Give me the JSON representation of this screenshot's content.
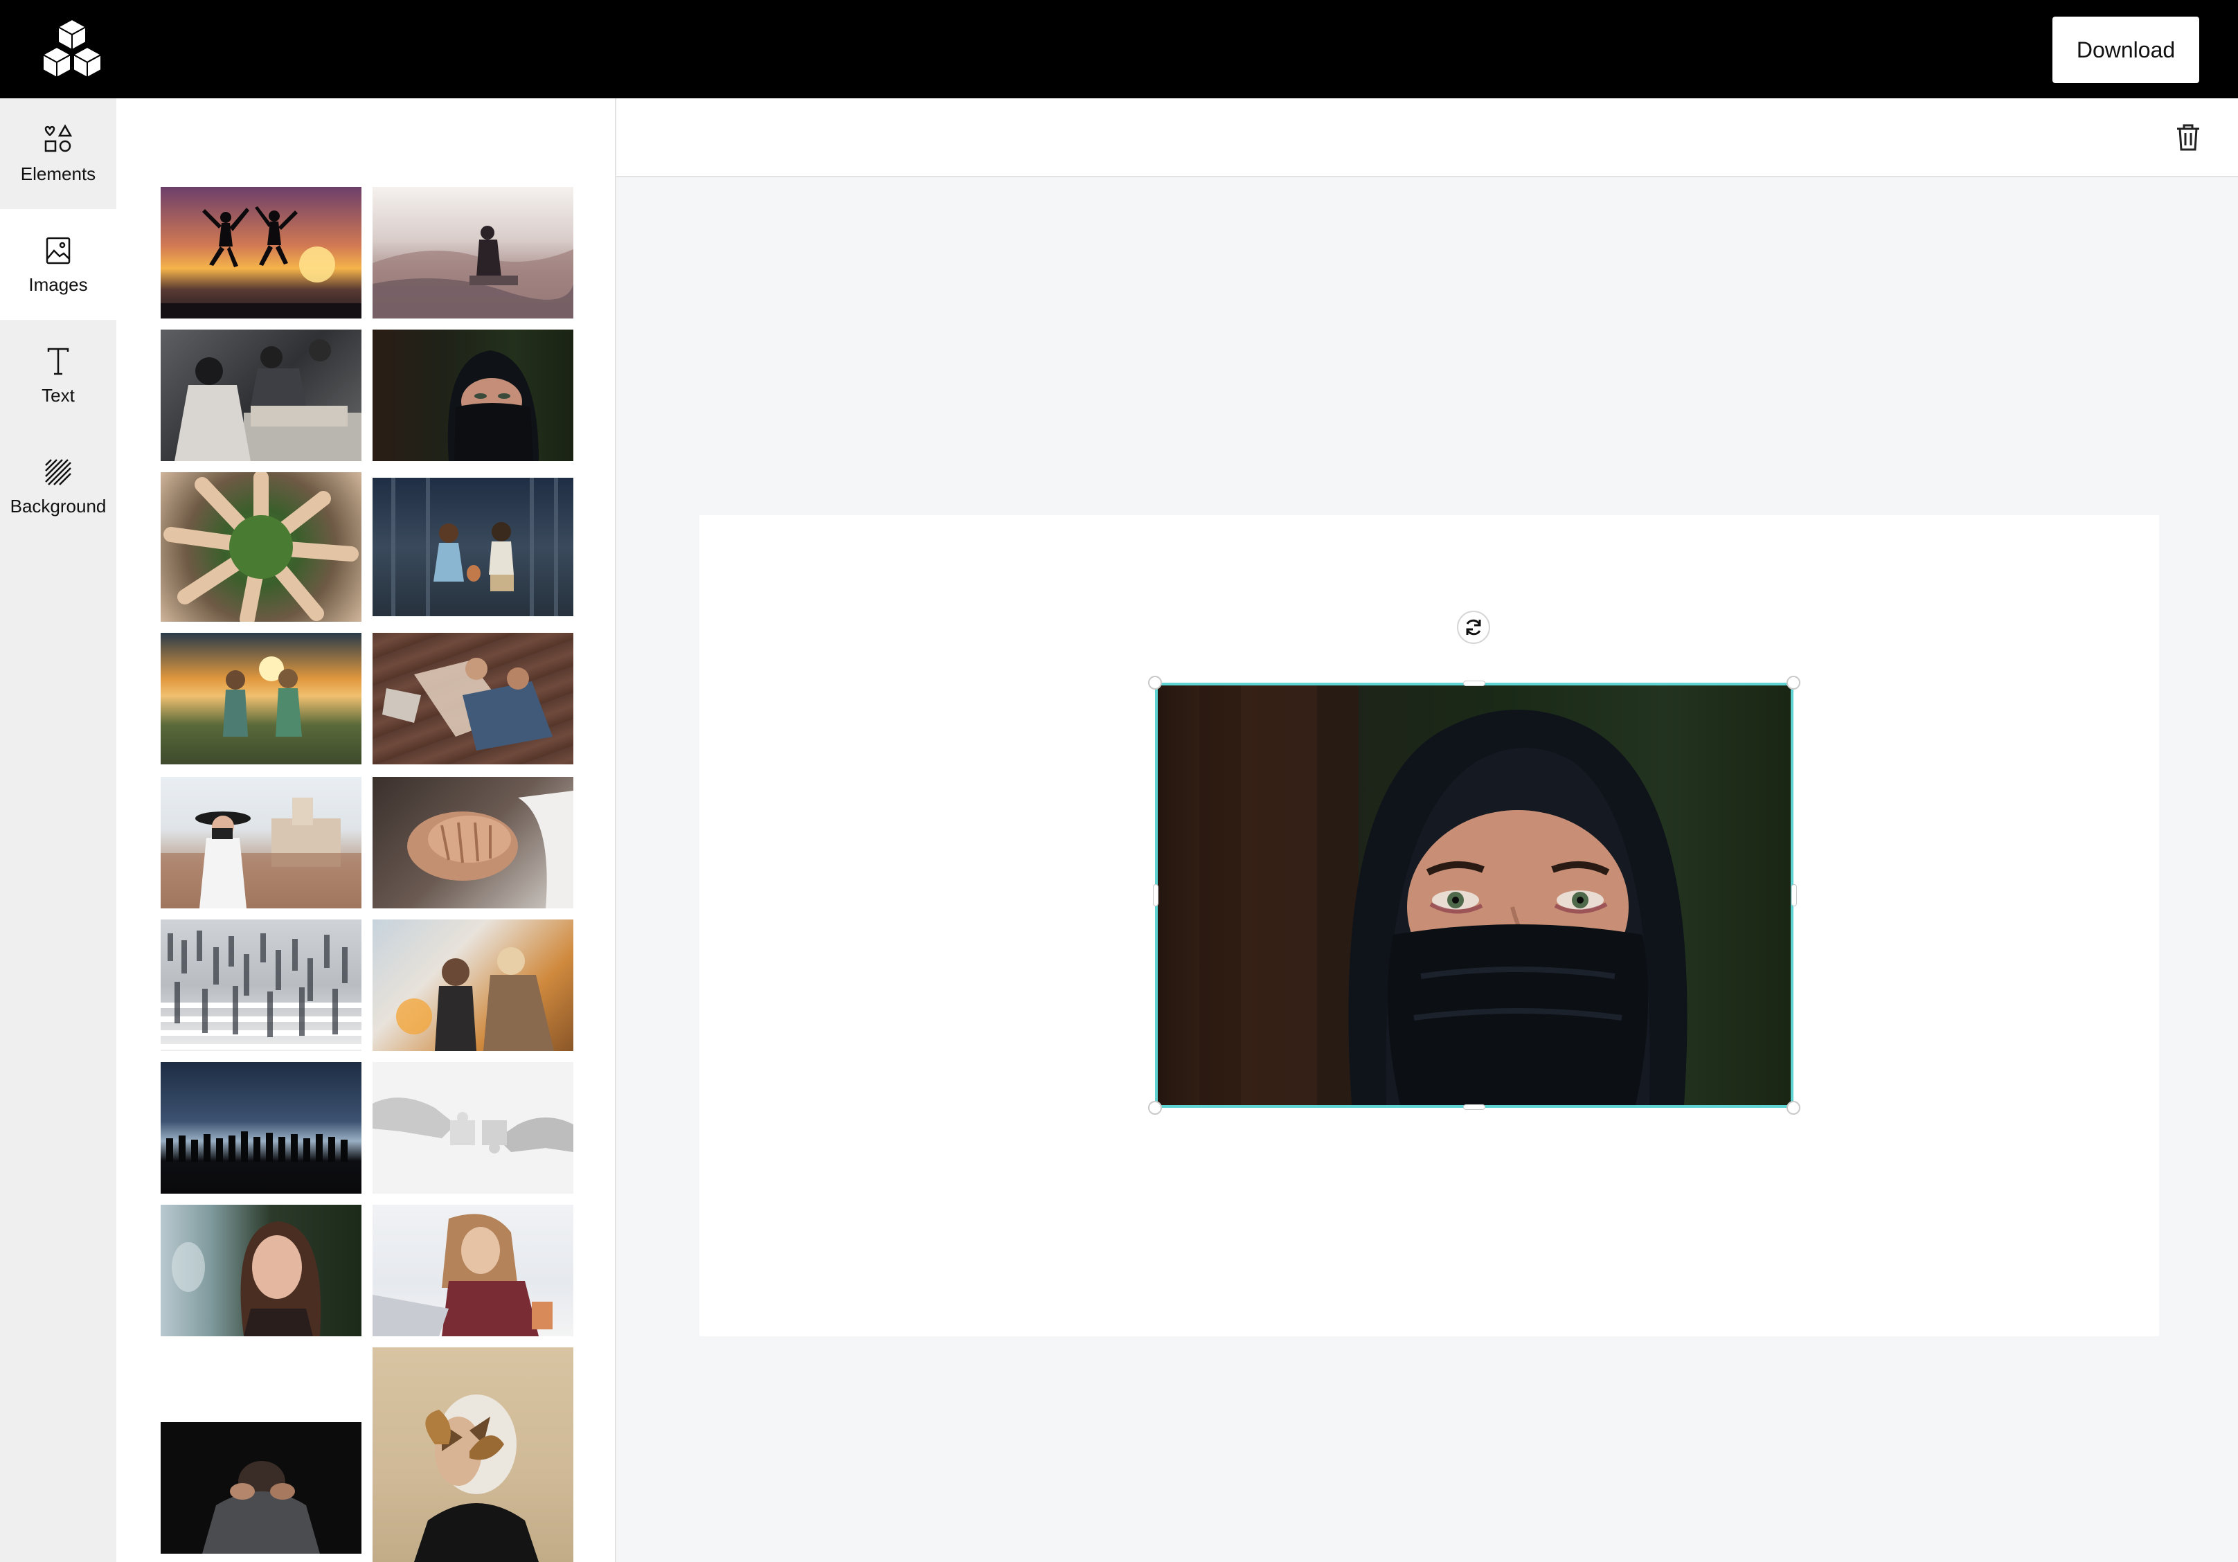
{
  "app": {
    "logo_icon": "cubes-logo-icon",
    "download_label": "Download"
  },
  "sidebar": {
    "items": [
      {
        "label": "Elements",
        "icon": "shapes-icon",
        "active": false
      },
      {
        "label": "Images",
        "icon": "image-icon",
        "active": true
      },
      {
        "label": "Text",
        "icon": "text-icon",
        "active": false
      },
      {
        "label": "Background",
        "icon": "hatch-pattern-icon",
        "active": false
      }
    ]
  },
  "image_library": {
    "thumbnails": [
      {
        "subject": "silhouettes jumping at sunset"
      },
      {
        "subject": "person sitting on mountain"
      },
      {
        "subject": "people working at table"
      },
      {
        "subject": "woman in black hijab"
      },
      {
        "subject": "hands in a circle on grass"
      },
      {
        "subject": "two children in forest"
      },
      {
        "subject": "children at sunset"
      },
      {
        "subject": "couple on wooden floor"
      },
      {
        "subject": "woman with camera on rooftop"
      },
      {
        "subject": "stacked hands"
      },
      {
        "subject": "crowd crossing street"
      },
      {
        "subject": "friends laughing"
      },
      {
        "subject": "group silhouette at night"
      },
      {
        "subject": "hands joining puzzle pieces"
      },
      {
        "subject": "woman by window"
      },
      {
        "subject": "woman at laptop"
      },
      {
        "subject": "man with head down"
      },
      {
        "subject": "woman with butterfly mask"
      }
    ]
  },
  "editor": {
    "trash_icon": "trash-icon",
    "rotate_icon": "rotate-icon",
    "selected_image": "woman in black hijab",
    "selection_color": "#5fd3d1"
  }
}
